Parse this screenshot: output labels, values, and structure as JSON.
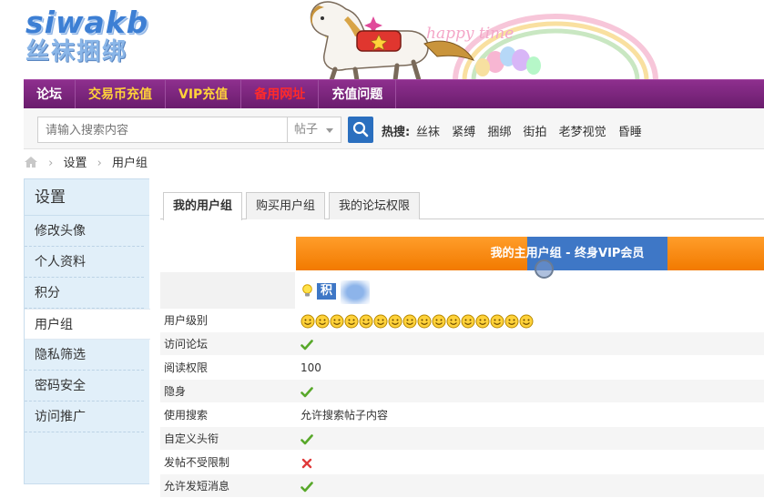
{
  "logo": {
    "top_text": "siwakb",
    "bottom_text": "丝袜捆绑"
  },
  "banner": {
    "tagline": "happy time"
  },
  "nav": {
    "items": [
      {
        "label": "论坛",
        "color": "#ffffff"
      },
      {
        "label": "交易币充值",
        "color": "#ffd23a"
      },
      {
        "label": "VIP充值",
        "color": "#ffd23a"
      },
      {
        "label": "备用网址",
        "color": "#ff2a2a"
      },
      {
        "label": "充值问题",
        "color": "#ffffff"
      }
    ]
  },
  "search": {
    "placeholder": "请输入搜索内容",
    "type_selected": "帖子",
    "hot_label": "热搜:",
    "hot_words": [
      "丝袜",
      "紧缚",
      "捆绑",
      "街拍",
      "老梦视觉",
      "昏睡"
    ]
  },
  "breadcrumb": {
    "items": [
      "设置",
      "用户组"
    ]
  },
  "sidebar": {
    "title": "设置",
    "items": [
      {
        "label": "修改头像",
        "active": false
      },
      {
        "label": "个人资料",
        "active": false
      },
      {
        "label": "积分",
        "active": false
      },
      {
        "label": "用户组",
        "active": true
      },
      {
        "label": "隐私筛选",
        "active": false
      },
      {
        "label": "密码安全",
        "active": false
      },
      {
        "label": "访问推广",
        "active": false
      }
    ]
  },
  "tabs": [
    {
      "label": "我的用户组",
      "active": true
    },
    {
      "label": "购买用户组",
      "active": false
    },
    {
      "label": "我的论坛权限",
      "active": false
    }
  ],
  "group": {
    "title": "我的主用户组 - 终身VIP会员"
  },
  "points": {
    "label": "积分"
  },
  "permissions": [
    {
      "label": "用户级别",
      "type": "level",
      "level_icon_count": 16
    },
    {
      "label": "访问论坛",
      "type": "check",
      "value": true
    },
    {
      "label": "阅读权限",
      "type": "text",
      "value": "100"
    },
    {
      "label": "隐身",
      "type": "check",
      "value": true
    },
    {
      "label": "使用搜索",
      "type": "text",
      "value": "允许搜索帖子内容"
    },
    {
      "label": "自定义头衔",
      "type": "check",
      "value": true
    },
    {
      "label": "发帖不受限制",
      "type": "check",
      "value": false
    },
    {
      "label": "允许发短消息",
      "type": "check",
      "value": true
    }
  ],
  "colors": {
    "nav_bg": "#7a2679",
    "accent_blue": "#3e77c6",
    "group_bar": "#f58a10",
    "check_green": "#58a82a",
    "cross_red": "#e03a3a"
  },
  "icons": {
    "home": "home-icon",
    "search": "search-icon",
    "caret": "chevron-down-icon",
    "bulb": "lightbulb-icon",
    "check": "check-icon",
    "cross": "cross-icon",
    "level": "smiley-icon"
  }
}
